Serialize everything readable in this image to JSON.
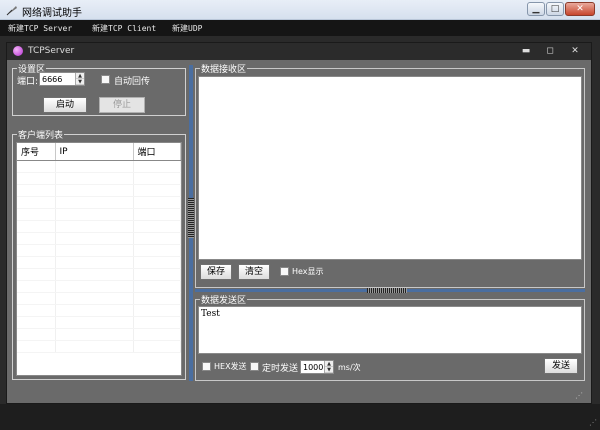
{
  "window": {
    "title": "网络调试助手",
    "min": "▁",
    "max": "□",
    "close": "✕"
  },
  "menu": [
    "新建TCP Server",
    "新建TCP Client",
    "新建UDP"
  ],
  "child": {
    "title": "TCPServer",
    "min": "▬",
    "max": "◻",
    "close": "✕"
  },
  "settings": {
    "label": "设置区",
    "port_label": "端口:",
    "port_value": "6666",
    "auto_reply": "自动回传",
    "start": "启动",
    "stop": "停止"
  },
  "clients": {
    "label": "客户端列表",
    "columns": [
      "序号",
      "IP",
      "端口"
    ]
  },
  "receive": {
    "label": "数据接收区",
    "save": "保存",
    "clear": "清空",
    "hex_display": "Hex显示"
  },
  "send": {
    "label": "数据发送区",
    "text": "Test",
    "hex_send": "HEX发送",
    "timed_send": "定时发送",
    "interval": "1000",
    "unit": "ms/次",
    "send_button": "发送"
  }
}
